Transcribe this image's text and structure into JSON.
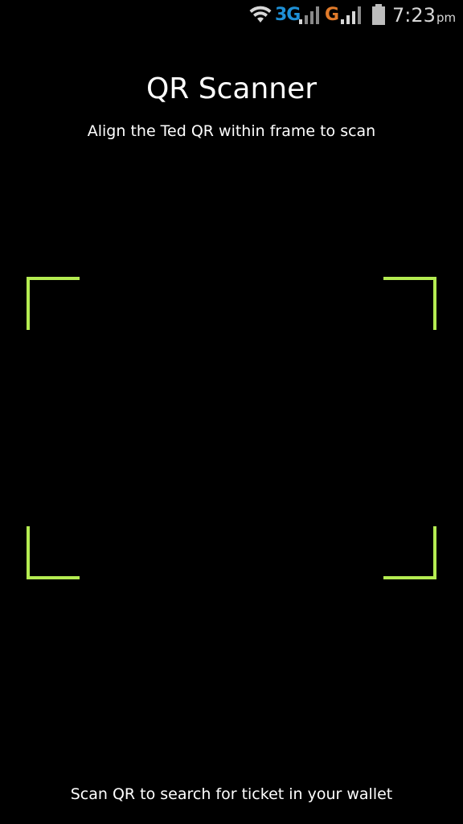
{
  "status_bar": {
    "network_type_1": "3G",
    "network_type_2": "G",
    "time": "7:23",
    "ampm": "pm",
    "icons": [
      "wifi-icon",
      "signal-icon",
      "signal-icon",
      "battery-icon"
    ],
    "colors": {
      "network_1": "#1e90d6",
      "network_2": "#e07a2a",
      "icon": "#d8d8d8"
    }
  },
  "header": {
    "title": "QR Scanner",
    "subtitle": "Align the Ted QR within frame to scan"
  },
  "scanner": {
    "frame_color": "#b4ec51"
  },
  "footer": {
    "hint": "Scan QR to search for ticket in your wallet"
  }
}
